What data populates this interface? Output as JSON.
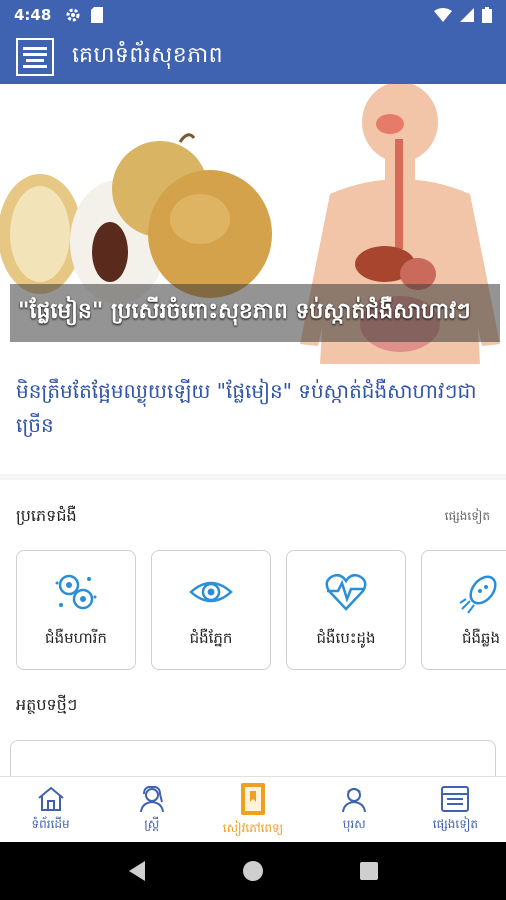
{
  "status_bar": {
    "time": "4:48",
    "icons": [
      "settings-icon",
      "sd-card-icon",
      "wifi-icon",
      "signal-icon",
      "battery-icon"
    ]
  },
  "app_bar": {
    "title": "គេហទំព័រសុខភាព",
    "logo_icon": "app-logo-icon"
  },
  "hero": {
    "caption": "\"ផ្លែមៀន\" ប្រសើរចំពោះសុខភាព ទប់ស្កាត់ជំងឺសាហាវៗ"
  },
  "headline": {
    "text": "មិនត្រឹមតែផ្អែមឈ្ងុយឡើយ \"ផ្លែមៀន\" ទប់ស្កាត់ជំងឺសាហាវៗជាច្រើន"
  },
  "categories": {
    "title": "ប្រភេទជំងឺ",
    "more": "ផ្សេងទៀត",
    "items": [
      {
        "label": "ជំងឺមហារីក",
        "icon": "virus-icon"
      },
      {
        "label": "ជំងឺភ្នែក",
        "icon": "eye-icon"
      },
      {
        "label": "ជំងឺបេះដូង",
        "icon": "heart-pulse-icon"
      },
      {
        "label": "ជំងឺឆ្លង",
        "icon": "bacteria-icon"
      }
    ]
  },
  "news": {
    "title": "អត្ថបទថ្មីៗ"
  },
  "bottom_nav": {
    "items": [
      {
        "label": "ទំព័រដើម",
        "icon": "home-icon",
        "active": false
      },
      {
        "label": "ស្ត្រី",
        "icon": "woman-icon",
        "active": false
      },
      {
        "label": "សៀវភៅពេទ្យ",
        "icon": "book-icon",
        "active": true
      },
      {
        "label": "បុរស",
        "icon": "man-icon",
        "active": false
      },
      {
        "label": "ផ្សេងទៀត",
        "icon": "more-icon",
        "active": false
      }
    ]
  },
  "colors": {
    "primary": "#3f63b0",
    "accent": "#f0a020",
    "headline": "#2f54a8",
    "icon_blue": "#2a8fd8"
  }
}
